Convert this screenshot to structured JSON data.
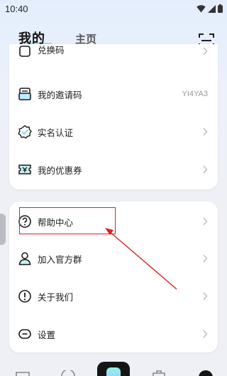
{
  "status": {
    "time": "10:40"
  },
  "tabs": [
    {
      "label": "我的",
      "active": true
    },
    {
      "label": "主页",
      "active": false
    }
  ],
  "menu_top": [
    {
      "label": "兑换码",
      "icon": "redeem-icon"
    },
    {
      "label": "我的邀请码",
      "icon": "invite-code-icon",
      "value": "YI4YA3"
    },
    {
      "label": "实名认证",
      "icon": "verify-badge-icon"
    },
    {
      "label": "我的优惠券",
      "icon": "coupon-icon"
    }
  ],
  "menu_bottom": [
    {
      "label": "帮助中心",
      "icon": "help-icon"
    },
    {
      "label": "加入官方群",
      "icon": "user-group-icon"
    },
    {
      "label": "关于我们",
      "icon": "info-icon"
    },
    {
      "label": "设置",
      "icon": "settings-icon"
    }
  ],
  "colors": {
    "accent": "#7de8e0",
    "annotation": "#e02020"
  }
}
